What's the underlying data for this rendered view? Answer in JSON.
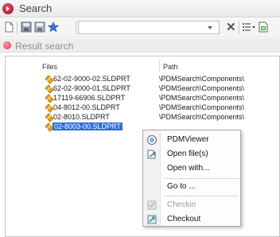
{
  "window": {
    "title": "Search"
  },
  "toolbar": {
    "search_value": "",
    "clear_symbol": "✕"
  },
  "result": {
    "label": "Result search"
  },
  "columns": {
    "files": "Files",
    "path": "Path"
  },
  "rows": [
    {
      "name": "62-02-9000-02.SLDPRT",
      "path": "\\PDMSearch\\Components\\"
    },
    {
      "name": "62-02-9000-01.SLDPRT",
      "path": "\\PDMSearch\\Components\\"
    },
    {
      "name": "17119-66906.SLDPRT",
      "path": "\\PDMSearch\\Components\\"
    },
    {
      "name": "04-8012-00.SLDPRT",
      "path": "\\PDMSearch\\Components\\"
    },
    {
      "name": "02-8010.SLDPRT",
      "path": "\\PDMSearch\\Components\\"
    },
    {
      "name": "02-8003-00.SLDPRT",
      "path": ""
    }
  ],
  "context_menu": {
    "items": [
      {
        "label": "PDMViewer",
        "icon": "viewer-icon",
        "enabled": true
      },
      {
        "label": "Open file(s)",
        "icon": "open-files-icon",
        "enabled": true
      },
      {
        "label": "Open with...",
        "icon": "",
        "enabled": true
      },
      {
        "label": "Go to ...",
        "icon": "",
        "enabled": true
      },
      {
        "label": "Checkin",
        "icon": "checkin-icon",
        "enabled": false
      },
      {
        "label": "Checkout",
        "icon": "checkout-icon",
        "enabled": true
      }
    ]
  },
  "colors": {
    "accent": "#c8102e",
    "selection": "#2f6bd8",
    "file_icon": "#e8a317"
  }
}
